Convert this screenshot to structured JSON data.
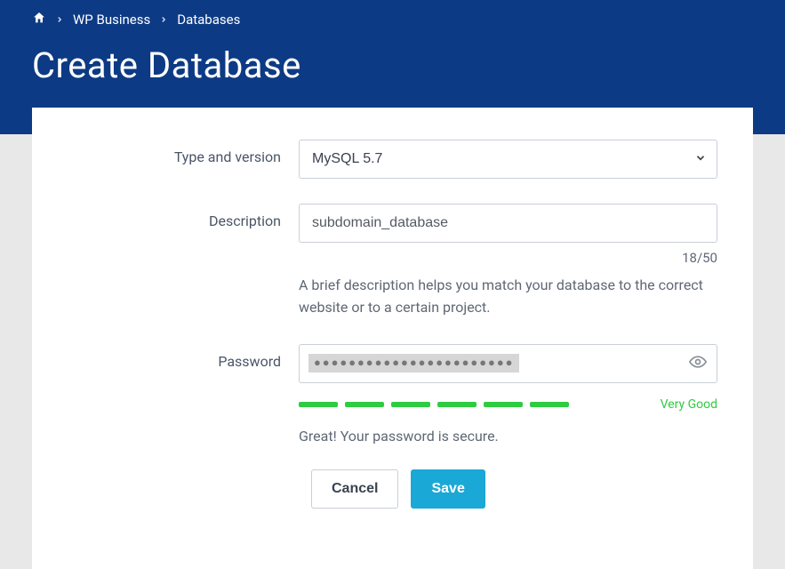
{
  "breadcrumb": {
    "items": [
      "WP Business",
      "Databases"
    ]
  },
  "page": {
    "title": "Create Database"
  },
  "form": {
    "type": {
      "label": "Type and version",
      "value": "MySQL 5.7"
    },
    "description": {
      "label": "Description",
      "value": "subdomain_database",
      "counter": "18/50",
      "help": "A brief description helps you match your database to the correct website or to a certain project."
    },
    "password": {
      "label": "Password",
      "mask": "●●●●●●●●●●●●●●●●●●●●●●●",
      "strength_label": "Very Good",
      "strength_msg": "Great! Your password is secure."
    },
    "actions": {
      "cancel": "Cancel",
      "save": "Save"
    }
  }
}
